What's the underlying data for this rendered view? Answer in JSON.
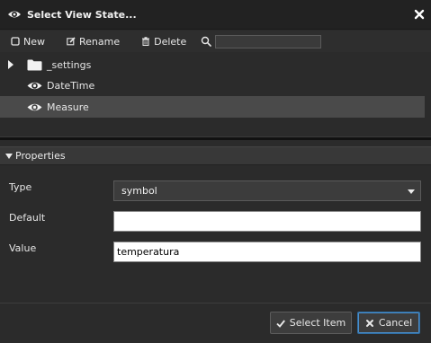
{
  "dialog": {
    "title": "Select View State...",
    "close_icon": "close-icon"
  },
  "toolbar": {
    "new_label": "New",
    "rename_label": "Rename",
    "delete_label": "Delete",
    "search_value": "",
    "search_placeholder": ""
  },
  "tree": {
    "items": [
      {
        "label": "_settings",
        "icon": "folder-icon",
        "expandable": true,
        "selected": false
      },
      {
        "label": "DateTime",
        "icon": "eye-icon",
        "expandable": false,
        "selected": false
      },
      {
        "label": "Measure",
        "icon": "eye-icon",
        "expandable": false,
        "selected": true
      }
    ]
  },
  "properties": {
    "header": "Properties",
    "type_label": "Type",
    "type_value": "symbol",
    "default_label": "Default",
    "default_value": "",
    "value_label": "Value",
    "value_value": "temperatura"
  },
  "footer": {
    "select_label": "Select Item",
    "cancel_label": "Cancel"
  },
  "colors": {
    "background": "#2b2b2b",
    "selected_row": "#4a4a4a",
    "accent_border": "#2e6da4"
  }
}
